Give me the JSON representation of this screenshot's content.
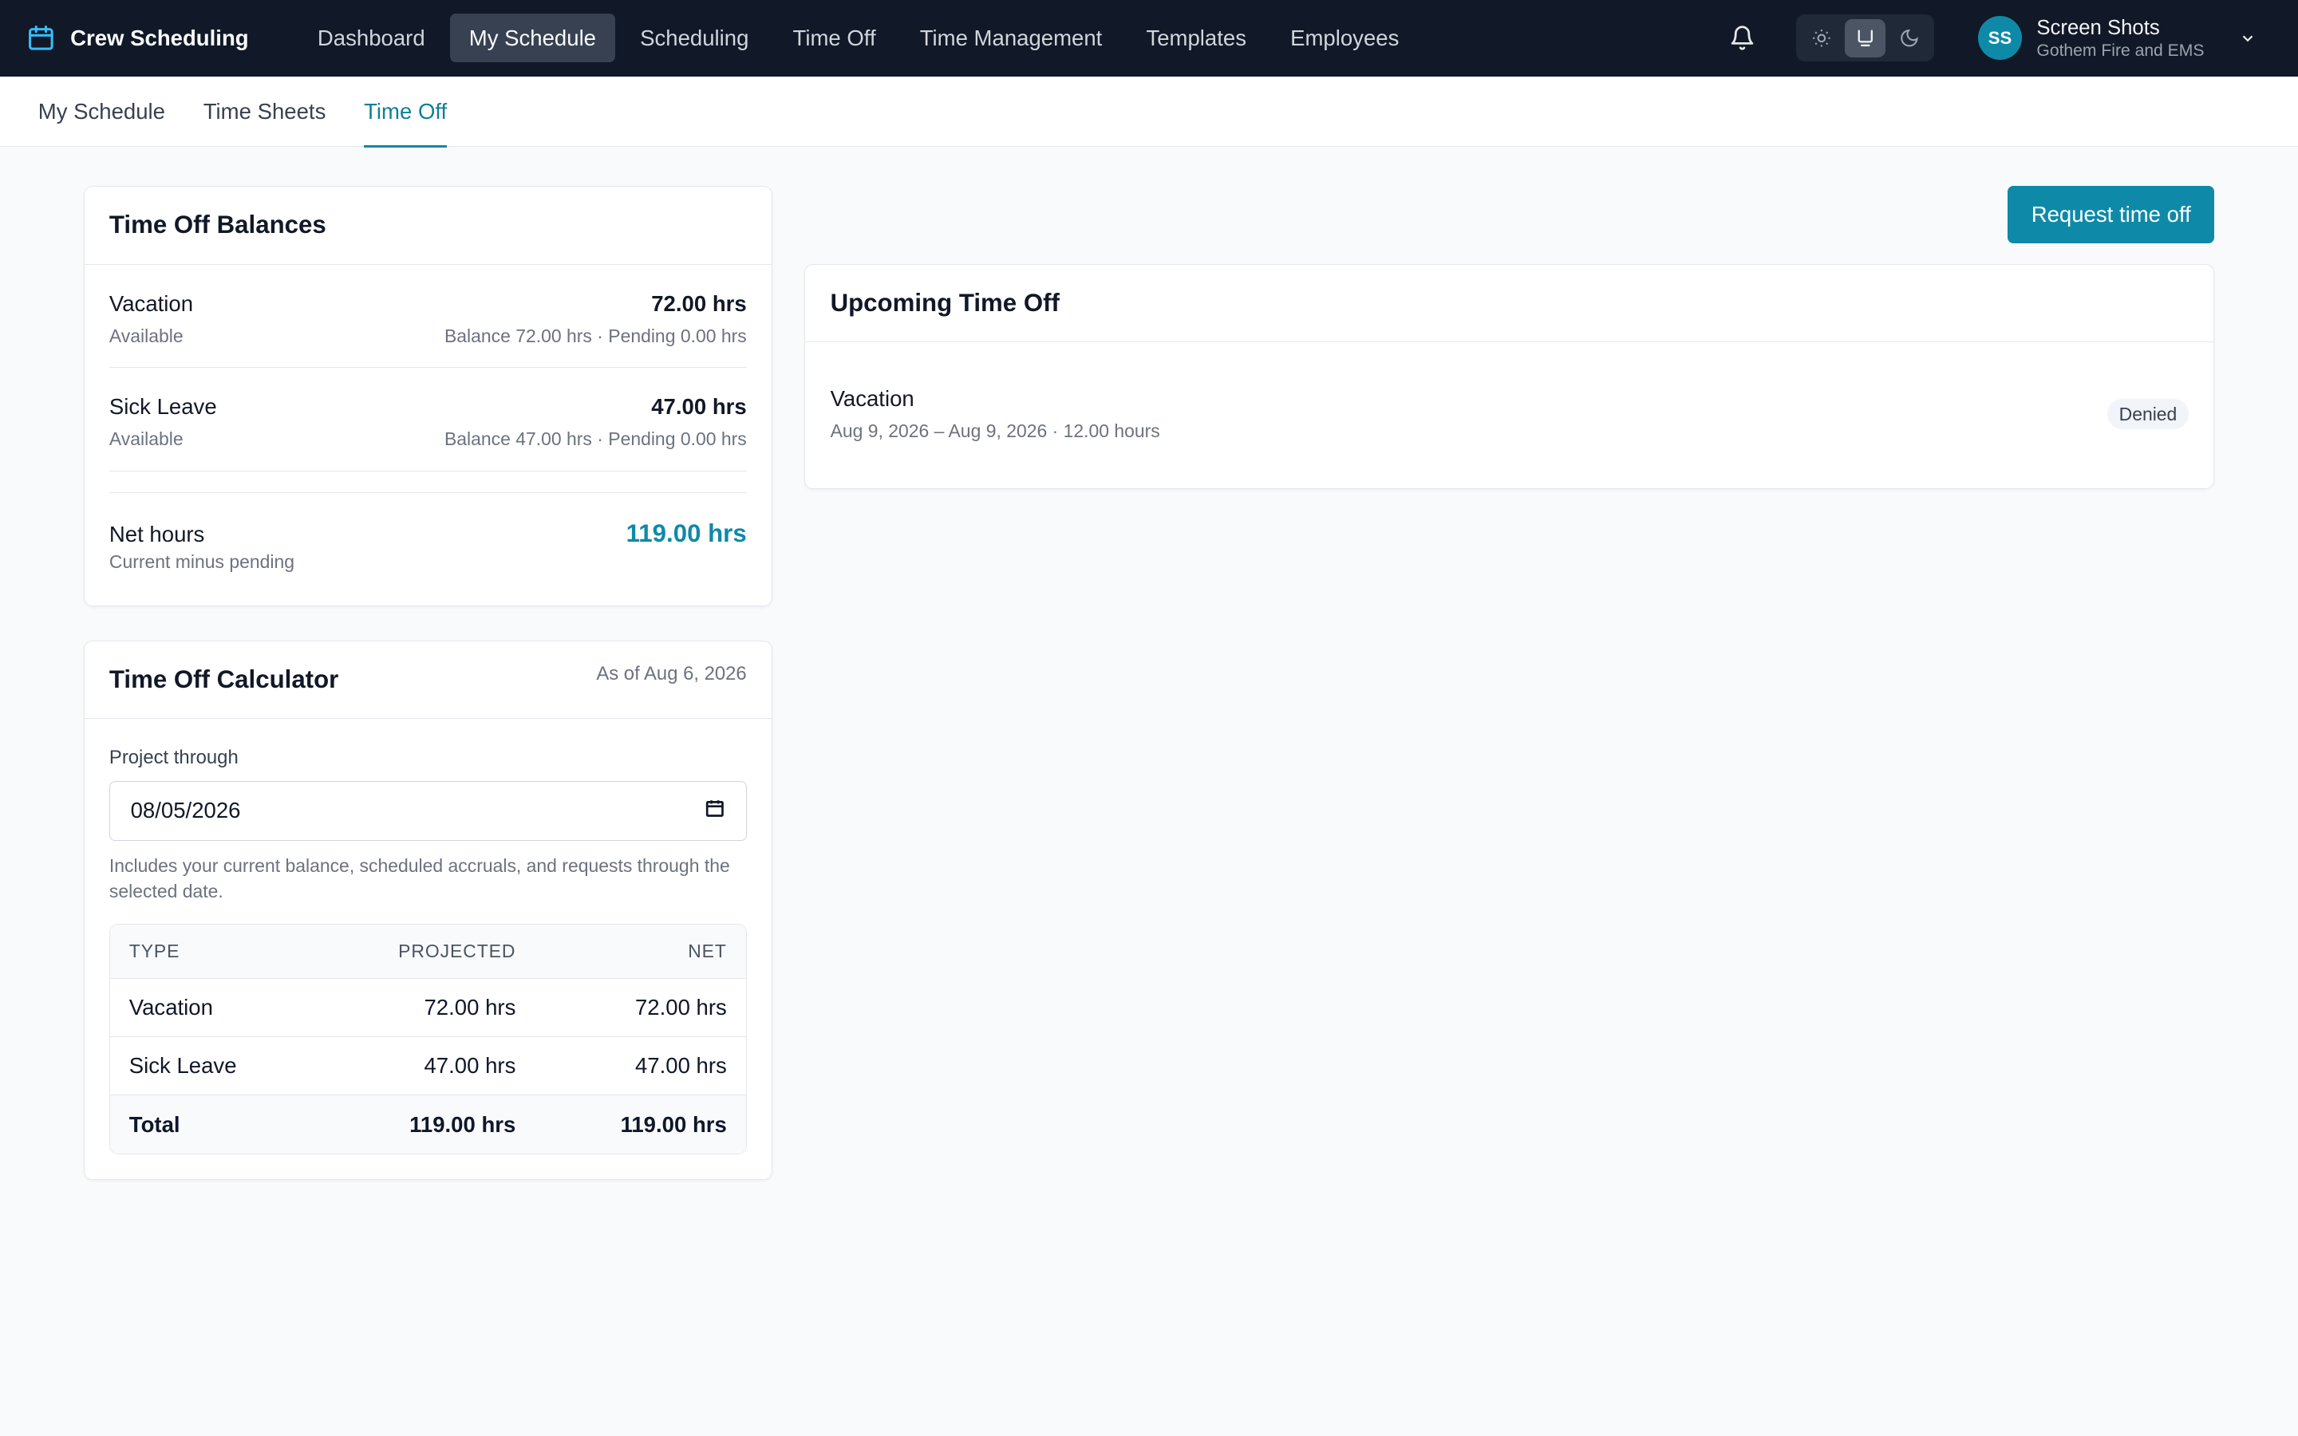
{
  "app": {
    "name": "Crew Scheduling"
  },
  "nav": {
    "items": [
      {
        "label": "Dashboard"
      },
      {
        "label": "My Schedule"
      },
      {
        "label": "Scheduling"
      },
      {
        "label": "Time Off"
      },
      {
        "label": "Time Management"
      },
      {
        "label": "Templates"
      },
      {
        "label": "Employees"
      }
    ],
    "active": "My Schedule"
  },
  "user": {
    "initials": "SS",
    "name": "Screen Shots",
    "org": "Gothem Fire and EMS"
  },
  "subtabs": [
    {
      "label": "My Schedule"
    },
    {
      "label": "Time Sheets"
    },
    {
      "label": "Time Off"
    }
  ],
  "balances": {
    "title": "Time Off Balances",
    "rows": [
      {
        "name": "Vacation",
        "value": "72.00 hrs",
        "status": "Available",
        "detail": "Balance 72.00 hrs · Pending 0.00 hrs"
      },
      {
        "name": "Sick Leave",
        "value": "47.00 hrs",
        "status": "Available",
        "detail": "Balance 47.00 hrs · Pending 0.00 hrs"
      }
    ],
    "net": {
      "label": "Net hours",
      "sub": "Current minus pending",
      "value": "119.00 hrs"
    }
  },
  "calculator": {
    "title": "Time Off Calculator",
    "as_of": "As of Aug 6, 2026",
    "field_label": "Project through",
    "date_value": "08/05/2026",
    "help": "Includes your current balance, scheduled accruals, and requests through the selected date.",
    "headers": {
      "type": "TYPE",
      "projected": "PROJECTED",
      "net": "NET"
    },
    "rows": [
      {
        "type": "Vacation",
        "projected": "72.00 hrs",
        "net": "72.00 hrs"
      },
      {
        "type": "Sick Leave",
        "projected": "47.00 hrs",
        "net": "47.00 hrs"
      }
    ],
    "total": {
      "type": "Total",
      "projected": "119.00 hrs",
      "net": "119.00 hrs"
    }
  },
  "request_button": "Request time off",
  "upcoming": {
    "title": "Upcoming Time Off",
    "items": [
      {
        "name": "Vacation",
        "detail": "Aug 9, 2026 – Aug 9, 2026 · 12.00 hours",
        "status": "Denied"
      }
    ]
  },
  "colors": {
    "accent": "#0e8aa8",
    "topbar": "#111827"
  }
}
